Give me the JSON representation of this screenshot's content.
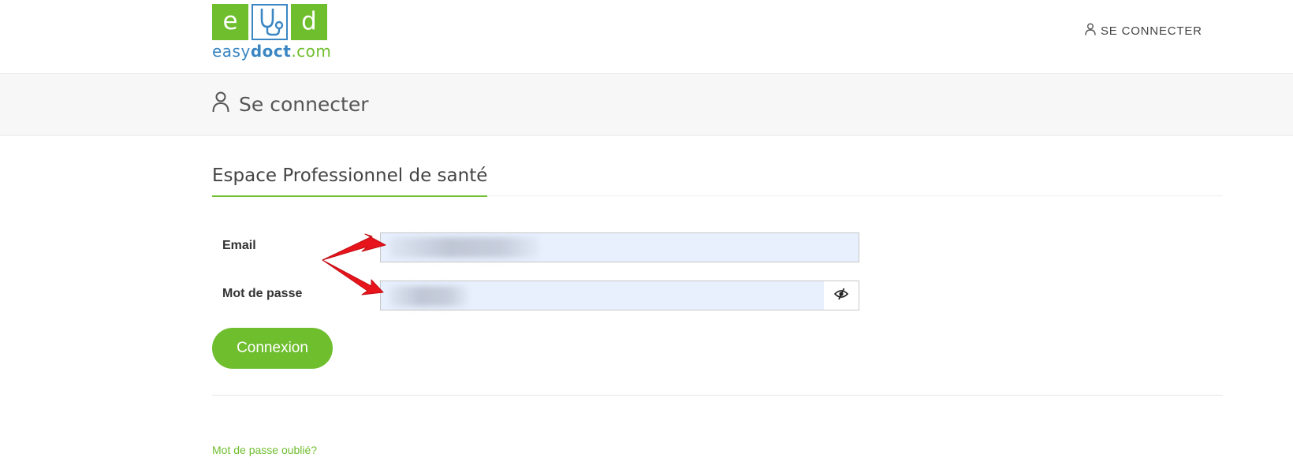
{
  "brand": {
    "logo_letters": [
      "e",
      "d"
    ],
    "logo_word_easy": "easy",
    "logo_word_doct": "doct",
    "logo_word_com": ".com",
    "colors": {
      "green": "#6fbe2e",
      "blue": "#3a86c3"
    }
  },
  "header": {
    "login_link": "SE CONNECTER",
    "login_icon": "user-icon"
  },
  "page": {
    "title": "Se connecter",
    "title_icon": "user-icon"
  },
  "form": {
    "section_title": "Espace Professionnel de santé",
    "email_label": "Email",
    "email_value": "",
    "password_label": "Mot de passe",
    "password_value": "",
    "password_toggle_icon": "eye-slash-icon",
    "submit_label": "Connexion",
    "forgot_link": "Mot de passe oublié?"
  },
  "annotations": {
    "arrow_color": "#e8141c",
    "arrow_icon": "red-arrow"
  }
}
